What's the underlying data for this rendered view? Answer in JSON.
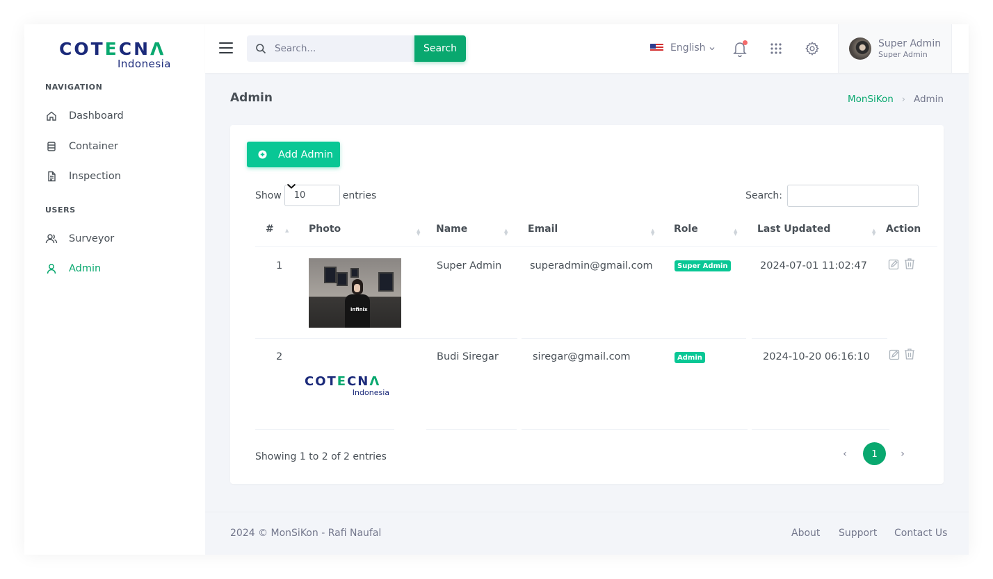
{
  "brand": {
    "logo_main_1": "COT",
    "logo_main_e": "E",
    "logo_main_2": "CN",
    "logo_main_a": "Λ",
    "logo_sub": "Indonesia"
  },
  "sidebar": {
    "navigation_title": "NAVIGATION",
    "users_title": "USERS",
    "items": [
      {
        "label": "Dashboard",
        "icon": "home-icon"
      },
      {
        "label": "Container",
        "icon": "container-icon"
      },
      {
        "label": "Inspection",
        "icon": "document-icon"
      },
      {
        "label": "Surveyor",
        "icon": "users-icon"
      },
      {
        "label": "Admin",
        "icon": "user-icon",
        "active": true
      }
    ]
  },
  "topbar": {
    "search_placeholder": "Search...",
    "search_button": "Search",
    "language": "English",
    "user_name": "Super Admin",
    "user_role": "Super Admin"
  },
  "page": {
    "title": "Admin",
    "breadcrumb_root": "MonSiKon",
    "breadcrumb_sep": "›",
    "breadcrumb_current": "Admin"
  },
  "table": {
    "add_button": "Add Admin",
    "show_label": "Show",
    "page_size": "10",
    "entries_label": "entries",
    "search_label": "Search:",
    "columns": [
      "#",
      "Photo",
      "Name",
      "Email",
      "Role",
      "Last Updated",
      "Action"
    ],
    "rows": [
      {
        "no": "1",
        "name": "Super Admin",
        "email": "superadmin@gmail.com",
        "role": "Super Admin",
        "updated": "2024-07-01 11:02:47"
      },
      {
        "no": "2",
        "name": "Budi Siregar",
        "email": "siregar@gmail.com",
        "role": "Admin",
        "updated": "2024-10-20 06:16:10"
      }
    ],
    "row2_logo_main_1": "COT",
    "row2_logo_main_e": "E",
    "row2_logo_main_2": "CN",
    "row2_logo_main_a": "Λ",
    "row2_logo_sub": "Indonesia",
    "photo1_text": "infinix",
    "info": "Showing 1 to 2 of 2 entries",
    "page_prev": "‹",
    "page_current": "1",
    "page_next": "›"
  },
  "footer": {
    "copyright": "2024 © MonSiKon - Rafi Naufal",
    "links": [
      "About",
      "Support",
      "Contact Us"
    ]
  },
  "colors": {
    "accent": "#09a86f",
    "accent_light": "#09c795",
    "brand_navy": "#1b2a7a"
  }
}
